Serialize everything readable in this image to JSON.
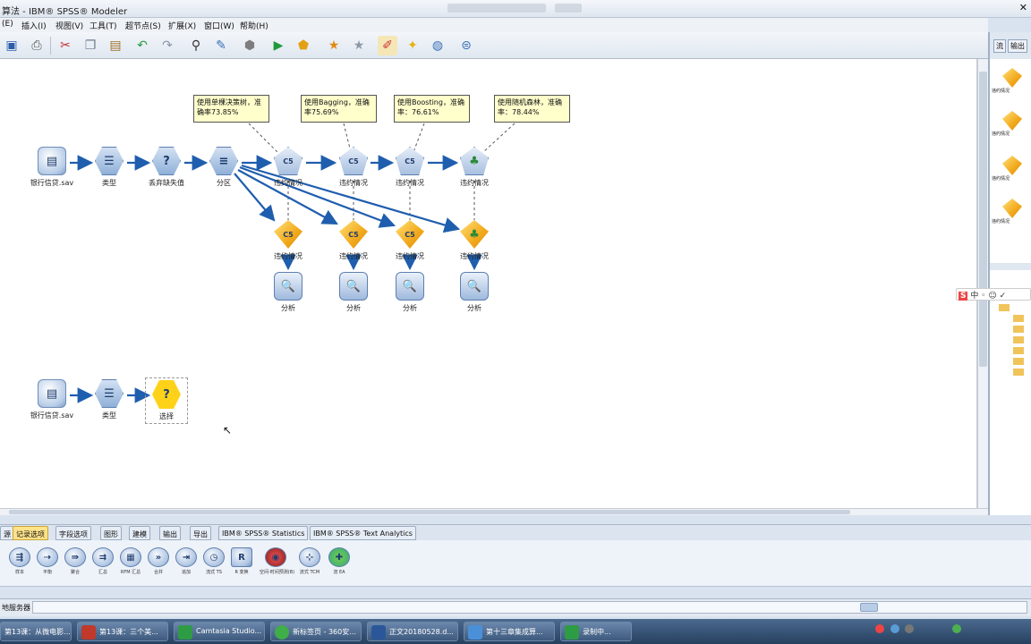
{
  "window": {
    "title": "算法 - IBM® SPSS® Modeler"
  },
  "menu": [
    "(E)",
    "插入(I)",
    "视图(V)",
    "工具(T)",
    "超节点(S)",
    "扩展(X)",
    "窗口(W)",
    "帮助(H)"
  ],
  "toolbar_icons": [
    "save-icon",
    "print-icon",
    "cut-icon",
    "copy-icon",
    "paste-icon",
    "undo-icon",
    "redo-icon",
    "find-icon",
    "edit-icon",
    "stop-icon",
    "run-icon",
    "run-selection-icon",
    "favorite-icon",
    "star-icon",
    "annotation-icon",
    "comment-icon",
    "globe-icon",
    "network-icon"
  ],
  "annotations": [
    "使用单棵决策树，准确率73.85%",
    "使用Bagging，准确率75.69%",
    "使用Boosting，准确率：76.61%",
    "使用随机森林，准确率：78.44%"
  ],
  "nodes": {
    "source1": "银行信贷.sav",
    "type1": "类型",
    "filter": "丢弃缺失值",
    "partition": "分区",
    "model_builders": [
      "违约情况",
      "违约情况",
      "违约情况",
      "违约情况"
    ],
    "model_nuggets": [
      "违约情况",
      "违约情况",
      "违约情况",
      "违约情况"
    ],
    "analysis": [
      "分析",
      "分析",
      "分析",
      "分析"
    ],
    "source2": "银行信贷.sav",
    "type2": "类型",
    "select": "选择"
  },
  "right_panel": {
    "tabs": [
      "流",
      "输出"
    ],
    "models": [
      "违约情况",
      "违约情况",
      "违约情况",
      "违约情况"
    ]
  },
  "palette_tabs": [
    "源",
    "记录选项",
    "字段选项",
    "图形",
    "建模",
    "输出",
    "导出",
    "IBM® SPSS® Statistics",
    "IBM® SPSS® Text Analytics"
  ],
  "palette_active": "记录选项",
  "palette_nodes": [
    "样本",
    "平衡",
    "聚合",
    "汇总",
    "RFM 汇总",
    "合并",
    "追加",
    "流式 TS",
    "R 变换",
    "空间-时间预测(B)",
    "流式 TCM",
    "流 EA"
  ],
  "status": {
    "server": "地服务器"
  },
  "taskbar": [
    {
      "label": "第13课：从微电影..."
    },
    {
      "label": "第13课：三个美..."
    },
    {
      "label": "Camtasia Studio..."
    },
    {
      "label": "新标签页 - 360安..."
    },
    {
      "label": "正文20180528.d..."
    },
    {
      "label": "第十三章集成算..."
    },
    {
      "label": "录制中..."
    }
  ],
  "colors": {
    "accent": "#ffe38a",
    "canvas": "#ffffff",
    "link": "#1f5eae"
  }
}
